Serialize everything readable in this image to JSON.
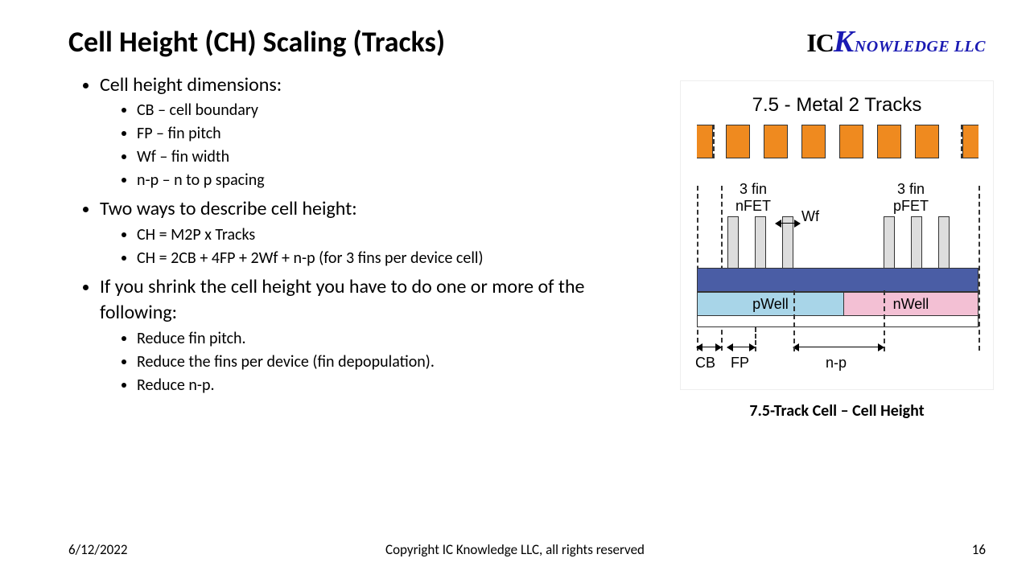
{
  "title": "Cell Height (CH) Scaling (Tracks)",
  "logo": {
    "ic": "IC",
    "bigK": "K",
    "rest": "NOWLEDGE",
    "llc": " LLC"
  },
  "bullets": {
    "b1": "Cell height dimensions:",
    "b1s": {
      "a": "CB – cell boundary",
      "b": "FP – fin pitch",
      "c": "Wf – fin width",
      "d": "n-p – n to p spacing"
    },
    "b2": "Two ways to describe cell height:",
    "b2s": {
      "a": "CH = M2P x Tracks",
      "b": "CH = 2CB + 4FP + 2Wf + n-p (for 3 fins per device cell)"
    },
    "b3": "If you shrink the cell height you have to do one or more of the following:",
    "b3s": {
      "a": "Reduce fin pitch.",
      "b": "Reduce the fins per device (fin depopulation).",
      "c": "Reduce n-p."
    }
  },
  "diagram": {
    "title": "7.5 - Metal 2 Tracks",
    "nfet_line1": "3 fin",
    "nfet_line2": "nFET",
    "pfet_line1": "3 fin",
    "pfet_line2": "pFET",
    "wf": "Wf",
    "pwell": "pWell",
    "nwell": "nWell",
    "cb": "CB",
    "fp": "FP",
    "np": "n-p",
    "caption": "7.5-Track Cell – Cell Height"
  },
  "footer": {
    "date": "6/12/2022",
    "copy": "Copyright IC Knowledge LLC, all rights reserved",
    "page": "16"
  }
}
